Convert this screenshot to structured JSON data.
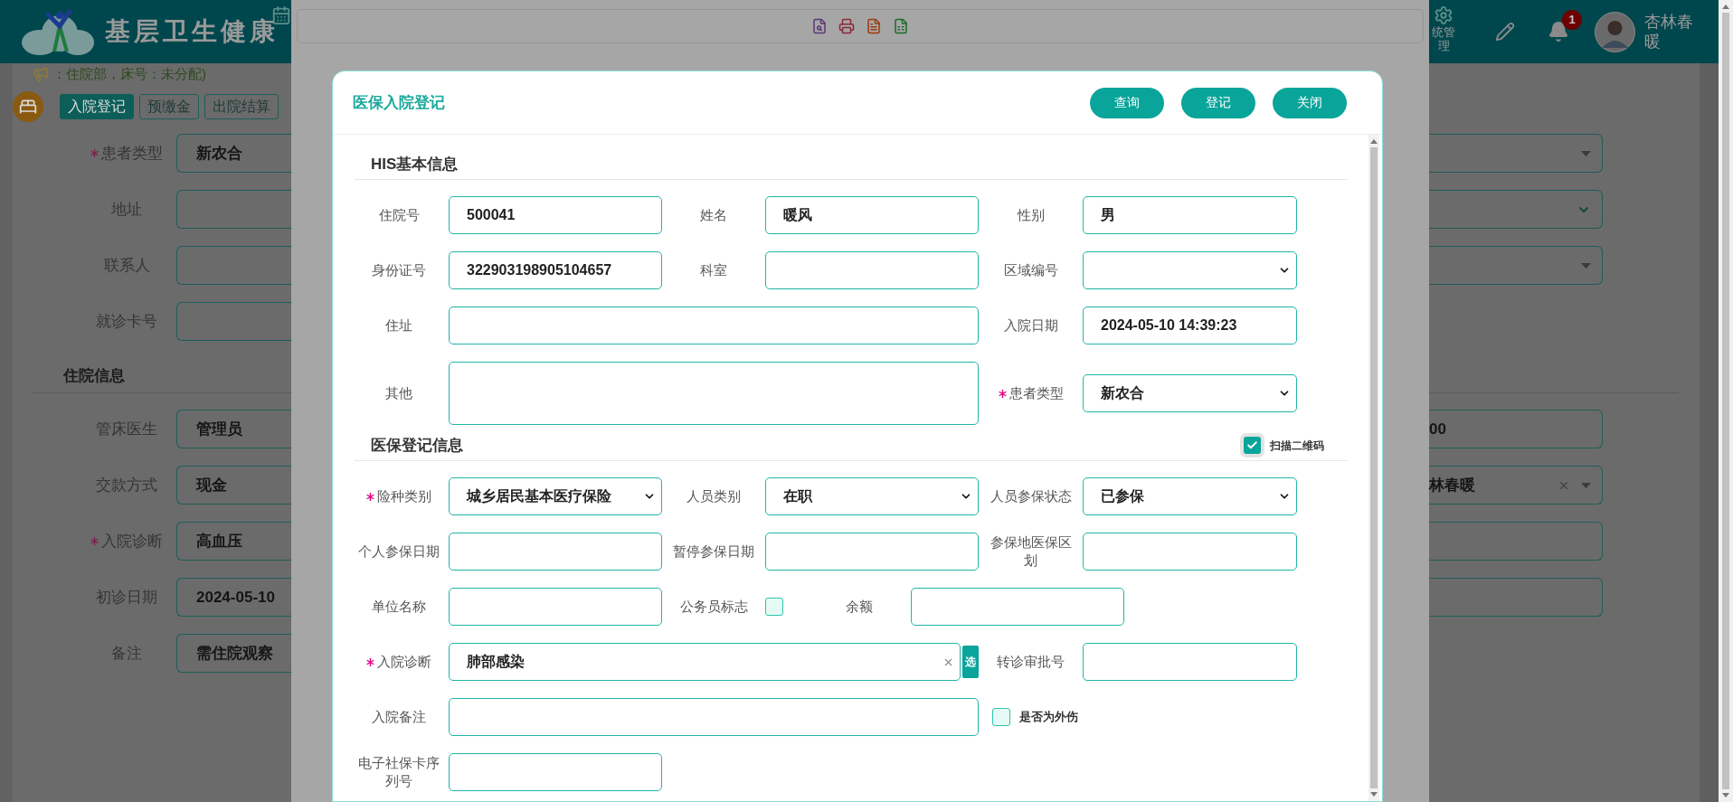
{
  "header": {
    "logo_text": "基层卫生健康",
    "nav_label": "统管理",
    "notification_count": "1",
    "user_name": "杏林春暖"
  },
  "breadcrumb": "：住院部，床号：未分配)",
  "page_tabs": [
    {
      "label": "入院登记",
      "selected": true
    },
    {
      "label": "预缴金",
      "selected": false
    },
    {
      "label": "出院结算",
      "selected": false
    }
  ],
  "background_form": {
    "groups": [
      {
        "rows": [
          {
            "label": "患者类型",
            "required": true,
            "value": "新农合",
            "right": {
              "kind": "dropdown"
            }
          },
          {
            "label": "地址",
            "required": false,
            "right": {
              "kind": "select"
            }
          },
          {
            "label": "联系人",
            "required": false,
            "right": {
              "kind": "dropdown"
            }
          },
          {
            "label": "就诊卡号",
            "required": false
          }
        ]
      },
      {
        "title": "住院信息",
        "rows": [
          {
            "label": "管床医生",
            "required": false,
            "value": "管理员",
            "right": {
              "kind": "input",
              "value": "00"
            }
          },
          {
            "label": "交款方式",
            "required": false,
            "value": "现金",
            "right": {
              "kind": "clearable",
              "value": "林春暖"
            }
          },
          {
            "label": "入院诊断",
            "required": true,
            "value": "高血压",
            "right": {
              "kind": "input"
            }
          },
          {
            "label": "初诊日期",
            "required": false,
            "value": "2024-05-10",
            "right": {
              "kind": "input"
            }
          },
          {
            "label": "备注",
            "required": false,
            "value": "需住院观察"
          }
        ]
      }
    ]
  },
  "modal": {
    "title": "医保入院登记",
    "buttons": [
      "查询",
      "登记",
      "关闭"
    ],
    "sections": [
      {
        "title": "HIS基本信息",
        "rows": [
          [
            {
              "kind": "input",
              "label": "住院号",
              "required": false,
              "value": "500041"
            },
            {
              "kind": "input",
              "label": "姓名",
              "required": false,
              "value": "暖风"
            },
            {
              "kind": "input",
              "label": "性别",
              "required": false,
              "value": "男"
            }
          ],
          [
            {
              "kind": "input",
              "label": "身份证号",
              "required": false,
              "value": "322903198905104657"
            },
            {
              "kind": "input",
              "label": "科室",
              "required": false
            },
            {
              "kind": "select",
              "label": "区域编号",
              "required": false
            }
          ],
          [
            {
              "kind": "wide_input",
              "label": "住址",
              "required": false
            },
            {
              "kind": "input",
              "label": "入院日期",
              "required": false,
              "value": "2024-05-10 14:39:23"
            }
          ],
          [
            {
              "kind": "textarea",
              "label": "其他",
              "required": false
            },
            {
              "kind": "select",
              "label": "患者类型",
              "required": true,
              "value": "新农合"
            }
          ]
        ]
      },
      {
        "title": "医保登记信息",
        "option": {
          "label": "扫描二维码",
          "checked": true
        },
        "rows": [
          [
            {
              "kind": "select",
              "label": "险种类别",
              "required": true,
              "value": "城乡居民基本医疗保险"
            },
            {
              "kind": "select",
              "label": "人员类别",
              "required": false,
              "value": "在职"
            },
            {
              "kind": "select",
              "label": "人员参保状态",
              "required": false,
              "value": "已参保"
            }
          ],
          [
            {
              "kind": "input",
              "label": "个人参保日期",
              "required": false
            },
            {
              "kind": "input",
              "label": "暂停参保日期",
              "required": false
            },
            {
              "kind": "input",
              "label": "参保地医保区划",
              "required": false
            }
          ],
          [
            {
              "kind": "input",
              "label": "单位名称",
              "required": false
            },
            {
              "kind": "checkbox",
              "label": "公务员标志",
              "required": false,
              "checked": false
            },
            {
              "kind": "input",
              "label": "余额",
              "required": false
            }
          ],
          [
            {
              "kind": "diagnosis",
              "label": "入院诊断",
              "required": true,
              "value": "肺部感染",
              "pick_label": "选"
            },
            {
              "kind": "input",
              "label": "转诊审批号",
              "required": false
            }
          ],
          [
            {
              "kind": "wide_input",
              "label": "入院备注",
              "required": false
            },
            {
              "kind": "flag",
              "label": "是否为外伤",
              "checked": false
            }
          ],
          [
            {
              "kind": "input",
              "label": "电子社保卡序列号",
              "required": false
            }
          ]
        ]
      }
    ]
  }
}
